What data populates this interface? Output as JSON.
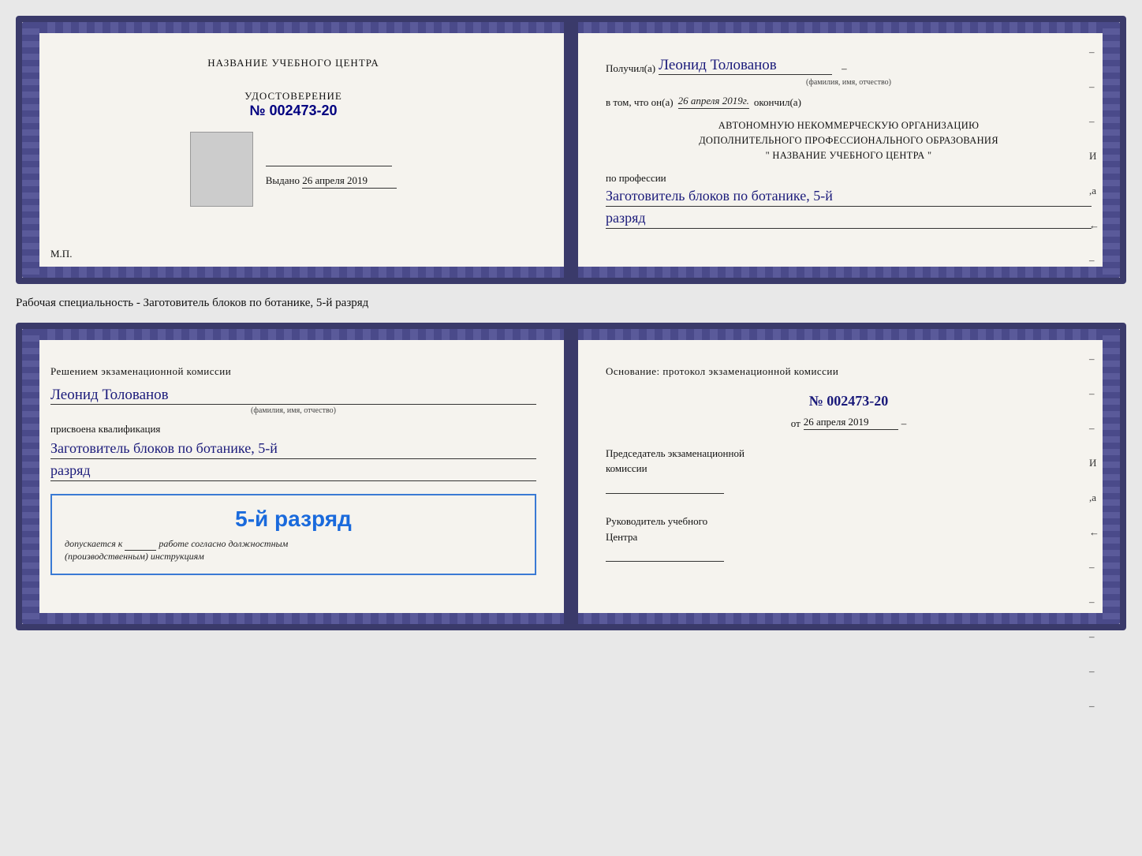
{
  "doc1": {
    "left": {
      "centerLabel": "НАЗВАНИЕ УЧЕБНОГО ЦЕНТРА",
      "udostoverenie": {
        "title": "УДОСТОВЕРЕНИЕ",
        "number": "№ 002473-20"
      },
      "vydano": {
        "label": "Выдано",
        "value": "26 апреля 2019"
      },
      "mp": "М.П."
    },
    "right": {
      "poluchil": "Получил(а)",
      "name": "Леонид Толованов",
      "fioCaption": "(фамилия, имя, отчество)",
      "vtom": "в том, что он(а)",
      "date": "26 апреля 2019г.",
      "okonchil": "окончил(а)",
      "orgLine1": "АВТОНОМНУЮ НЕКОММЕРЧЕСКУЮ ОРГАНИЗАЦИЮ",
      "orgLine2": "ДОПОЛНИТЕЛЬНОГО ПРОФЕССИОНАЛЬНОГО ОБРАЗОВАНИЯ",
      "orgLine3": "\"    НАЗВАНИЕ УЧЕБНОГО ЦЕНТРА    \"",
      "poProfessii": "по профессии",
      "profession": "Заготовитель блоков по ботанике, 5-й",
      "razryad": "разряд"
    }
  },
  "specialtyLabel": "Рабочая специальность - Заготовитель блоков по ботанике, 5-й разряд",
  "doc2": {
    "left": {
      "resheniem": "Решением экзаменационной комиссии",
      "name": "Леонид Толованов",
      "fioCaption": "(фамилия, имя, отчество)",
      "prisvoena": "присвоена квалификация",
      "profession": "Заготовитель блоков по ботанике, 5-й",
      "razryad": "разряд",
      "bigRazryad": "5-й разряд",
      "dopuskaetsya": "допускается к",
      "rabota": "работе согласно должностным",
      "instruktsii": "(производственным) инструкциям"
    },
    "right": {
      "osnovanie": "Основание: протокол экзаменационной комиссии",
      "number": "№  002473-20",
      "ot": "от",
      "date": "26 апреля 2019",
      "predsedatelLabel": "Председатель экзаменационной",
      "komissii": "комиссии",
      "rukovoditelLabel": "Руководитель учебного",
      "tsentra": "Центра"
    },
    "dashes": [
      "-",
      "-",
      "-",
      "И",
      ",а",
      "←",
      "-",
      "-",
      "-",
      "-",
      "-"
    ]
  }
}
